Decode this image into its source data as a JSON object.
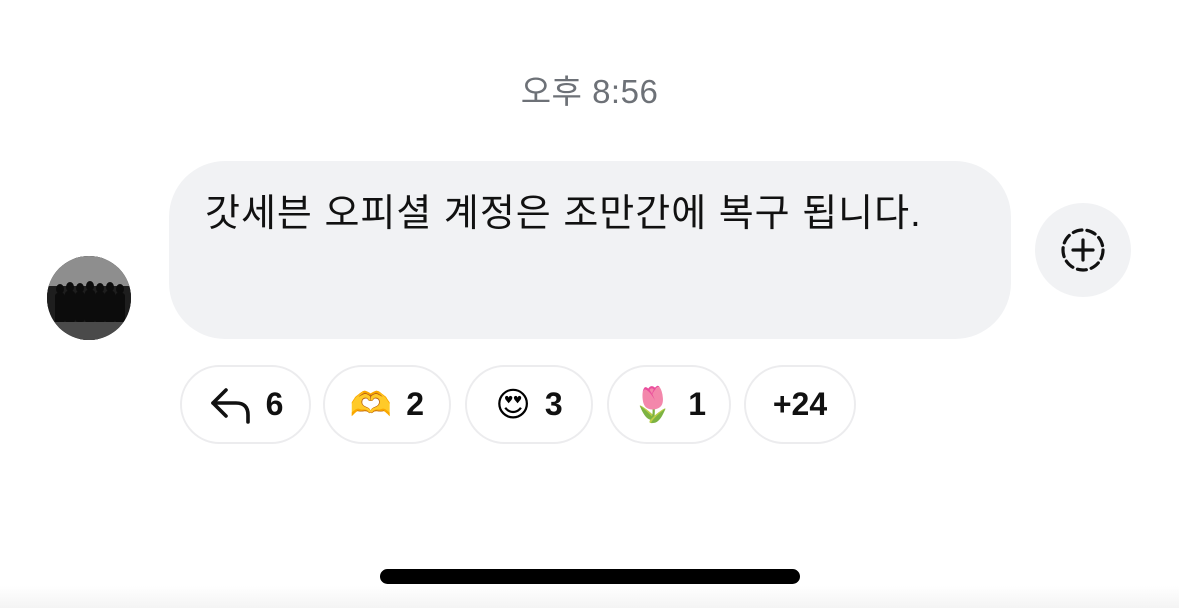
{
  "timestamp": "오후 8:56",
  "message": {
    "text": "갓세븐 오피셜 계정은 조만간에 복구 됩니다.",
    "bubble_color": "#f1f2f4"
  },
  "reactions": [
    {
      "icon": "reply-arrow-icon",
      "count": "6"
    },
    {
      "icon": "heart-hands-emoji",
      "emoji": "🫶",
      "count": "2"
    },
    {
      "icon": "heart-eyes-emoji",
      "emoji": "😍",
      "count": "3"
    },
    {
      "icon": "tulip-emoji",
      "emoji": "🌷",
      "count": "1"
    },
    {
      "more": "+24"
    }
  ],
  "add_reaction_icon": "add-reaction-icon"
}
